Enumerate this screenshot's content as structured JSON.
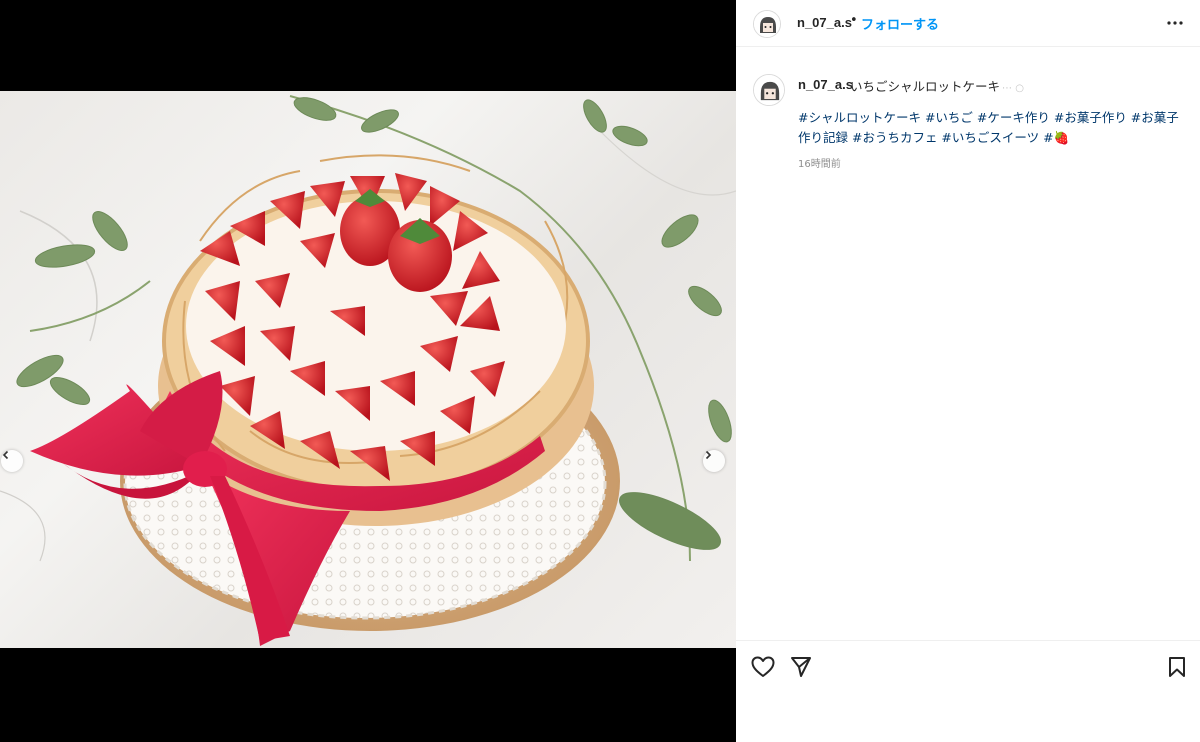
{
  "post": {
    "username": "n_07_a.s",
    "separator": "•",
    "follow_label": "フォローする",
    "more_icon": "more-horizontal-icon"
  },
  "caption": {
    "username": "n_07_a.s",
    "title": "いちごシャルロットケーキ",
    "title_trailing": "⋯ ○",
    "hashtags_line1": "#シャルロットケーキ #いちご #ケーキ作り #お菓子作り #お菓子",
    "hashtags_line2": "作り記録 #おうちカフェ #いちごスイーツ #🍓",
    "time": "16時間前"
  },
  "media": {
    "alt_subject": "strawberry charlotte cake",
    "prev_icon": "chevron-left-icon",
    "next_icon": "chevron-right-icon"
  },
  "actions": {
    "like_icon": "heart-icon",
    "share_icon": "paper-plane-icon",
    "save_icon": "bookmark-icon"
  },
  "colors": {
    "follow_blue": "#0095f6",
    "hashtag": "#00376b",
    "time_gray": "#8e8e8e",
    "ribbon": "#e8234f",
    "strawberry": "#d9232d"
  }
}
